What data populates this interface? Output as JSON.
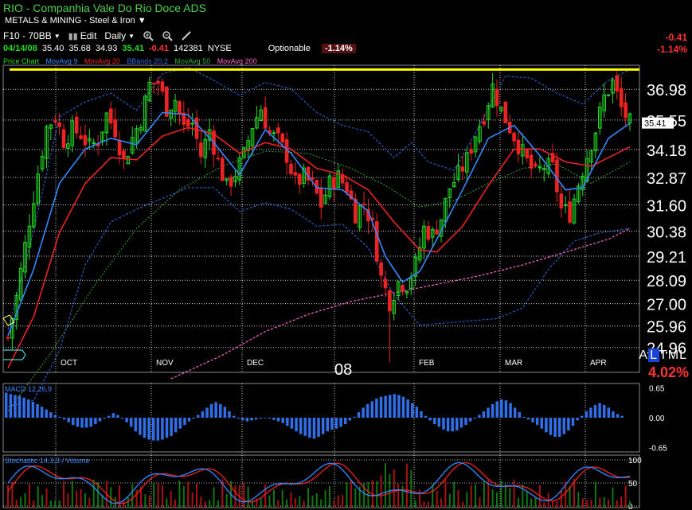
{
  "header": {
    "title": "RIO - Companhia Vale Do Rio Doce ADS",
    "sector": "METALS & MINING - Steel & Iron"
  },
  "toolbar": {
    "layout": "F10 - 70BB",
    "edit": "Edit",
    "period": "Daily"
  },
  "quote": {
    "date": "04/14/08",
    "open": "35.40",
    "high": "35.68",
    "low": "34.93",
    "close": "35.41",
    "change": "-0.41",
    "volume": "142381",
    "exchange": "NYSE",
    "optionable": "Optionable",
    "change_pct": "-1.14%"
  },
  "top_right": {
    "change": "-0.41",
    "change_pct": "-1.14%"
  },
  "legend": {
    "price_chart": "Price Chart",
    "ma9": "MovAvg 9",
    "ma20": "MovAvg 20",
    "bbands": "BBands 20,2",
    "ma50": "MovAvg 50",
    "ma200": "MovAvg 200"
  },
  "colors": {
    "up": "#22dd22",
    "down": "#ee2222",
    "ma9": "#3388ff",
    "ma20": "#ee2222",
    "bbands": "#3366dd",
    "ma50": "#33aa33",
    "ma200": "#ff66cc",
    "resistance": "#ffff00",
    "grid": "#ffffff",
    "macd": "#2f6fe8"
  },
  "tml": {
    "a": "A",
    "l": "L",
    "rest": "TML"
  },
  "tml_pct": "4.02%",
  "chart_data": [
    {
      "type": "candlestick",
      "x": [
        "OCT",
        "NOV",
        "DEC",
        "08",
        "FEB",
        "MAR",
        "APR"
      ],
      "y_ticks": [
        36.98,
        35.55,
        34.18,
        32.87,
        31.6,
        30.38,
        29.21,
        28.09,
        27.0,
        25.96,
        24.96
      ],
      "ylim": [
        23.8,
        38.1
      ],
      "last_price": 35.41,
      "resistance_level": 37.9,
      "series": [
        {
          "name": "Price",
          "points": [
            [
              0,
              25.4
            ],
            [
              2,
              27.3
            ],
            [
              5,
              30.9
            ],
            [
              7,
              33.1
            ],
            [
              9,
              35.2
            ],
            [
              11,
              35.7
            ],
            [
              13,
              34.6
            ],
            [
              15,
              35.1
            ],
            [
              17,
              34.9
            ],
            [
              19,
              34.3
            ],
            [
              21,
              34.6
            ],
            [
              23,
              35.8
            ],
            [
              25,
              35.1
            ],
            [
              27,
              33.6
            ],
            [
              29,
              34.7
            ],
            [
              31,
              35.6
            ],
            [
              33,
              37.2
            ],
            [
              35,
              37.3
            ],
            [
              37,
              36.1
            ],
            [
              39,
              36.5
            ],
            [
              41,
              35.2
            ],
            [
              43,
              35.4
            ],
            [
              45,
              33.9
            ],
            [
              47,
              35.1
            ],
            [
              49,
              33.6
            ],
            [
              51,
              32.4
            ],
            [
              53,
              33.1
            ],
            [
              55,
              33.9
            ],
            [
              57,
              35.3
            ],
            [
              59,
              36.1
            ],
            [
              61,
              34.9
            ],
            [
              63,
              34.6
            ],
            [
              65,
              33.9
            ],
            [
              67,
              32.6
            ],
            [
              69,
              32.9
            ],
            [
              71,
              32.5
            ],
            [
              73,
              31.6
            ],
            [
              75,
              32.6
            ],
            [
              77,
              32.9
            ],
            [
              79,
              32.4
            ],
            [
              81,
              31.2
            ],
            [
              83,
              31.7
            ],
            [
              85,
              30.6
            ],
            [
              87,
              28.2
            ],
            [
              89,
              27.1
            ],
            [
              91,
              28.0
            ],
            [
              93,
              27.9
            ],
            [
              95,
              28.8
            ],
            [
              97,
              30.5
            ],
            [
              99,
              30.2
            ],
            [
              101,
              31.0
            ],
            [
              103,
              32.4
            ],
            [
              105,
              33.0
            ],
            [
              107,
              33.7
            ],
            [
              109,
              34.9
            ],
            [
              111,
              35.8
            ],
            [
              113,
              37.1
            ],
            [
              115,
              36.0
            ],
            [
              117,
              35.2
            ],
            [
              119,
              34.4
            ],
            [
              121,
              33.6
            ],
            [
              123,
              33.0
            ],
            [
              125,
              33.4
            ],
            [
              127,
              33.3
            ],
            [
              129,
              31.4
            ],
            [
              131,
              31.2
            ],
            [
              133,
              32.6
            ],
            [
              135,
              33.9
            ],
            [
              137,
              35.1
            ],
            [
              139,
              36.6
            ],
            [
              141,
              37.3
            ],
            [
              143,
              36.1
            ],
            [
              145,
              35.41
            ]
          ]
        },
        {
          "name": "MovAvg 9",
          "points": [
            [
              0,
              25.5
            ],
            [
              6,
              28.6
            ],
            [
              12,
              32.6
            ],
            [
              18,
              34.2
            ],
            [
              24,
              34.7
            ],
            [
              30,
              34.4
            ],
            [
              36,
              35.9
            ],
            [
              42,
              35.8
            ],
            [
              48,
              34.5
            ],
            [
              54,
              33.0
            ],
            [
              60,
              35.1
            ],
            [
              66,
              34.0
            ],
            [
              72,
              32.4
            ],
            [
              78,
              32.3
            ],
            [
              84,
              31.3
            ],
            [
              88,
              29.2
            ],
            [
              92,
              28.0
            ],
            [
              96,
              28.5
            ],
            [
              100,
              30.0
            ],
            [
              106,
              32.3
            ],
            [
              112,
              34.7
            ],
            [
              118,
              35.3
            ],
            [
              124,
              33.9
            ],
            [
              130,
              32.3
            ],
            [
              134,
              32.4
            ],
            [
              140,
              34.7
            ],
            [
              145,
              35.4
            ]
          ]
        },
        {
          "name": "MovAvg 20",
          "points": [
            [
              0,
              24.0
            ],
            [
              6,
              26.4
            ],
            [
              12,
              30.3
            ],
            [
              18,
              32.6
            ],
            [
              24,
              33.8
            ],
            [
              30,
              33.7
            ],
            [
              36,
              34.8
            ],
            [
              42,
              35.2
            ],
            [
              48,
              34.9
            ],
            [
              54,
              34.0
            ],
            [
              60,
              34.5
            ],
            [
              66,
              34.2
            ],
            [
              72,
              33.3
            ],
            [
              78,
              33.0
            ],
            [
              84,
              32.3
            ],
            [
              90,
              30.8
            ],
            [
              96,
              29.5
            ],
            [
              100,
              29.4
            ],
            [
              106,
              30.6
            ],
            [
              112,
              32.5
            ],
            [
              118,
              34.2
            ],
            [
              124,
              34.2
            ],
            [
              130,
              33.6
            ],
            [
              136,
              33.4
            ],
            [
              142,
              34.0
            ],
            [
              145,
              34.3
            ]
          ]
        },
        {
          "name": "MovAvg 50",
          "points": [
            [
              0,
              22.0
            ],
            [
              10,
              24.7
            ],
            [
              20,
              27.8
            ],
            [
              30,
              30.5
            ],
            [
              40,
              32.3
            ],
            [
              50,
              33.4
            ],
            [
              60,
              34.1
            ],
            [
              70,
              34.0
            ],
            [
              80,
              33.3
            ],
            [
              88,
              32.5
            ],
            [
              96,
              31.5
            ],
            [
              104,
              31.8
            ],
            [
              112,
              32.6
            ],
            [
              120,
              33.3
            ],
            [
              128,
              33.5
            ],
            [
              136,
              32.6
            ],
            [
              145,
              33.6
            ]
          ]
        },
        {
          "name": "MovAvg 200",
          "points": [
            [
              38,
              23.5
            ],
            [
              50,
              24.6
            ],
            [
              60,
              25.7
            ],
            [
              70,
              26.5
            ],
            [
              80,
              27.1
            ],
            [
              90,
              27.5
            ],
            [
              100,
              27.9
            ],
            [
              110,
              28.3
            ],
            [
              120,
              28.8
            ],
            [
              130,
              29.4
            ],
            [
              140,
              30.0
            ],
            [
              145,
              30.5
            ]
          ]
        },
        {
          "name": "BBands upper",
          "points": [
            [
              0,
              25.8
            ],
            [
              6,
              30.4
            ],
            [
              12,
              35.7
            ],
            [
              18,
              36.4
            ],
            [
              24,
              36.8
            ],
            [
              30,
              36.0
            ],
            [
              36,
              37.7
            ],
            [
              42,
              38.0
            ],
            [
              48,
              37.4
            ],
            [
              54,
              36.7
            ],
            [
              60,
              37.3
            ],
            [
              66,
              37.0
            ],
            [
              72,
              35.9
            ],
            [
              78,
              35.3
            ],
            [
              84,
              35.0
            ],
            [
              90,
              33.8
            ],
            [
              94,
              34.5
            ],
            [
              98,
              33.6
            ],
            [
              104,
              33.2
            ],
            [
              110,
              35.3
            ],
            [
              116,
              37.6
            ],
            [
              122,
              37.5
            ],
            [
              128,
              36.8
            ],
            [
              134,
              36.3
            ],
            [
              140,
              37.4
            ],
            [
              145,
              37.9
            ]
          ]
        },
        {
          "name": "BBands lower",
          "points": [
            [
              0,
              22.2
            ],
            [
              6,
              22.5
            ],
            [
              12,
              24.8
            ],
            [
              18,
              28.8
            ],
            [
              24,
              30.8
            ],
            [
              30,
              31.4
            ],
            [
              36,
              31.9
            ],
            [
              42,
              32.4
            ],
            [
              48,
              32.4
            ],
            [
              54,
              31.3
            ],
            [
              60,
              31.7
            ],
            [
              66,
              31.4
            ],
            [
              72,
              30.6
            ],
            [
              78,
              30.7
            ],
            [
              84,
              29.6
            ],
            [
              90,
              27.4
            ],
            [
              96,
              26.0
            ],
            [
              102,
              26.1
            ],
            [
              108,
              26.2
            ],
            [
              114,
              26.3
            ],
            [
              120,
              26.8
            ],
            [
              126,
              28.6
            ],
            [
              132,
              29.9
            ],
            [
              138,
              30.3
            ],
            [
              145,
              30.5
            ]
          ]
        }
      ]
    },
    {
      "type": "bar",
      "name": "MACD 12,26,9",
      "y_ticks": [
        "0.65",
        "0.00",
        "-0.65"
      ],
      "ylim": [
        -0.75,
        0.75
      ],
      "values": [
        0.55,
        0.52,
        0.5,
        0.48,
        0.44,
        0.4,
        0.35,
        0.3,
        0.24,
        0.18,
        0.12,
        0.06,
        0.02,
        -0.04,
        -0.1,
        -0.16,
        -0.2,
        -0.22,
        -0.22,
        -0.2,
        -0.14,
        -0.08,
        -0.02,
        0.04,
        0.1,
        0.06,
        -0.02,
        -0.1,
        -0.2,
        -0.3,
        -0.38,
        -0.44,
        -0.48,
        -0.5,
        -0.5,
        -0.48,
        -0.44,
        -0.4,
        -0.32,
        -0.24,
        -0.16,
        -0.08,
        -0.02,
        0.06,
        0.14,
        0.22,
        0.3,
        0.34,
        0.3,
        0.24,
        0.14,
        0.04,
        -0.02,
        -0.06,
        -0.08,
        -0.06,
        -0.04,
        -0.02,
        -0.01,
        -0.02,
        -0.05,
        -0.08,
        -0.12,
        -0.18,
        -0.24,
        -0.3,
        -0.36,
        -0.4,
        -0.44,
        -0.46,
        -0.42,
        -0.36,
        -0.3,
        -0.26,
        -0.24,
        -0.2,
        -0.14,
        -0.06,
        0.02,
        0.12,
        0.22,
        0.3,
        0.36,
        0.42,
        0.46,
        0.48,
        0.5,
        0.52,
        0.5,
        0.46,
        0.4,
        0.32,
        0.24,
        0.14,
        0.04,
        -0.06,
        -0.14,
        -0.2,
        -0.26,
        -0.3,
        -0.3,
        -0.28,
        -0.22,
        -0.16,
        -0.08,
        -0.02,
        0.06,
        0.14,
        0.22,
        0.3,
        0.36,
        0.4,
        0.38,
        0.32,
        0.22,
        0.12,
        0.02,
        -0.04,
        -0.1,
        -0.16,
        -0.24,
        -0.32,
        -0.38,
        -0.42,
        -0.42,
        -0.36,
        -0.28,
        -0.18,
        -0.06,
        0.04,
        0.14,
        0.22,
        0.28,
        0.32,
        0.28,
        0.22,
        0.14,
        0.08,
        0.04
      ]
    },
    {
      "type": "line",
      "name": "Stochastic 14,3,3 / Volume",
      "y_ticks": [
        "100",
        "50",
        "0"
      ],
      "ylim": [
        0,
        100
      ]
    }
  ]
}
